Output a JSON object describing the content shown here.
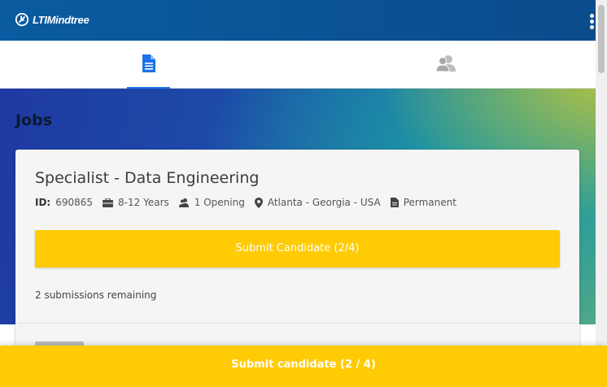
{
  "app": {
    "logo_text": "LTIMindtree"
  },
  "tabs": [
    {
      "name": "jobs",
      "icon": "document-icon",
      "active": true
    },
    {
      "name": "people",
      "icon": "people-icon",
      "active": false
    }
  ],
  "page": {
    "heading": "Jobs"
  },
  "job": {
    "title": "Specialist - Data Engineering",
    "id_label": "ID:",
    "id": "690865",
    "experience": "8-12 Years",
    "openings": "1 Opening",
    "location": "Atlanta - Georgia - USA",
    "type": "Permanent",
    "submit_label": "Submit Candidate (2/4)",
    "remaining_text": "2 submissions remaining"
  },
  "bottom_bar": {
    "label": "Submit candidate (2 / 4)"
  },
  "colors": {
    "header_bg": "#0a5ba0",
    "accent": "#1a73e8",
    "button": "#ffcb05"
  }
}
